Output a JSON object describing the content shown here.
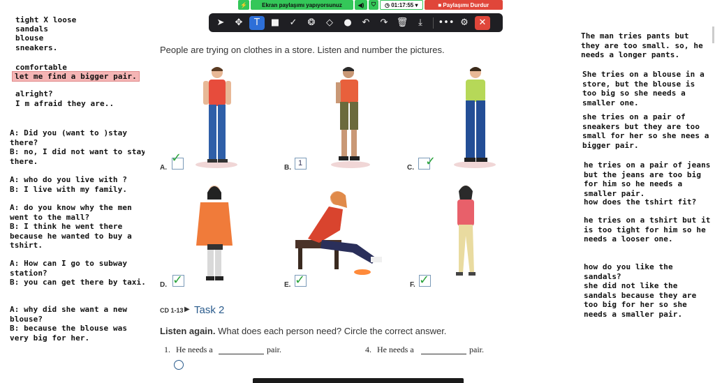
{
  "share_bar": {
    "sharing_label": "Ekran paylaşımı yapıyorsunuz",
    "timer": "01:17:55",
    "stop_label": "Paylaşımı Durdur"
  },
  "toolbar": {
    "tools": [
      "pointer-icon",
      "move-icon",
      "text-icon",
      "rectangle-icon",
      "check-icon",
      "stamp-icon",
      "eraser-icon",
      "dot-icon",
      "undo-icon",
      "redo-icon",
      "trash-icon",
      "download-icon",
      "more-icon",
      "settings-icon",
      "close-icon"
    ]
  },
  "left_notes": {
    "n1": "tight X loose",
    "n2": "sandals",
    "n3": "blouse",
    "n4": "sneakers.",
    "n5": "comfortable",
    "n6": "let me find a bigger pair.",
    "n7": "alright?",
    "n8": "I m afraid they are..",
    "n9": "A: Did you (want to )stay\nthere?\nB: no, I did not want to stay\nthere.",
    "n10": "A: who do you live with ?\nB: I live with my family.",
    "n11": "A: do you know why the men\nwent to the mall?\nB: I think he went there\nbecause he wanted to buy a\ntshirt.",
    "n12": "A: How can I go to subway\nstation?\nB: you can get there by taxi.",
    "n13": "A: why did she want a new\nblouse?\nB: because the blouse was\nvery big for her."
  },
  "right_notes": {
    "r1": "The man tries pants but they are too small. so, he needs a longer pants.",
    "r2": "She tries on a blouse in a store, but the blouse is too big so she needs a smaller one.",
    "r3": "she tries on a pair of sneakers but they are too small for her so she nees a bigger pair.",
    "r4": "he tries on a pair of jeans but the jeans are too big for him so he needs a smaller pair.",
    "r5": "how does the tshirt fit?",
    "r6": "he tries on a tshirt but it is too tight for him so he needs a looser one.",
    "r7": "how do you like the sandals?",
    "r8": "she did not like the sandals because they are too big for her so she needs a smaller pair."
  },
  "worksheet": {
    "instruction": "People are trying on clothes in a store. Listen and number the pictures.",
    "letters": [
      "A.",
      "B.",
      "C.",
      "D.",
      "E.",
      "F."
    ],
    "box_b_number": "1",
    "task_code": "CD 1-13",
    "task_title": "Task 2",
    "task_instruction_bold": "Listen again.",
    "task_instruction_rest": " What does each person need? Circle the correct answer.",
    "q1_num": "1.",
    "q1_text_a": "He needs a",
    "q1_text_b": "pair.",
    "q4_num": "4.",
    "q4_text_a": "He needs a",
    "q4_text_b": "pair."
  },
  "colors": {
    "share_green": "#34c759",
    "share_stop": "#e0463a",
    "toolbar_bg": "#1f1f23",
    "highlight": "#f5b5b5",
    "task_blue": "#2a5b8c",
    "check_green": "#2aa33a"
  }
}
